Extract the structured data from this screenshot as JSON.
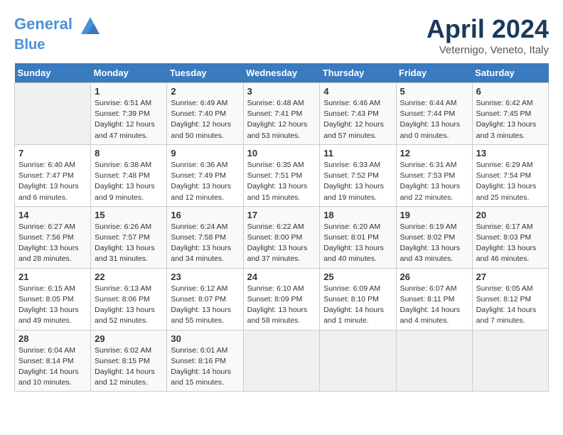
{
  "header": {
    "logo_line1": "General",
    "logo_line2": "Blue",
    "month": "April 2024",
    "location": "Veternigo, Veneto, Italy"
  },
  "weekdays": [
    "Sunday",
    "Monday",
    "Tuesday",
    "Wednesday",
    "Thursday",
    "Friday",
    "Saturday"
  ],
  "weeks": [
    [
      {
        "num": "",
        "sunrise": "",
        "sunset": "",
        "daylight": ""
      },
      {
        "num": "1",
        "sunrise": "Sunrise: 6:51 AM",
        "sunset": "Sunset: 7:39 PM",
        "daylight": "Daylight: 12 hours and 47 minutes."
      },
      {
        "num": "2",
        "sunrise": "Sunrise: 6:49 AM",
        "sunset": "Sunset: 7:40 PM",
        "daylight": "Daylight: 12 hours and 50 minutes."
      },
      {
        "num": "3",
        "sunrise": "Sunrise: 6:48 AM",
        "sunset": "Sunset: 7:41 PM",
        "daylight": "Daylight: 12 hours and 53 minutes."
      },
      {
        "num": "4",
        "sunrise": "Sunrise: 6:46 AM",
        "sunset": "Sunset: 7:43 PM",
        "daylight": "Daylight: 12 hours and 57 minutes."
      },
      {
        "num": "5",
        "sunrise": "Sunrise: 6:44 AM",
        "sunset": "Sunset: 7:44 PM",
        "daylight": "Daylight: 13 hours and 0 minutes."
      },
      {
        "num": "6",
        "sunrise": "Sunrise: 6:42 AM",
        "sunset": "Sunset: 7:45 PM",
        "daylight": "Daylight: 13 hours and 3 minutes."
      }
    ],
    [
      {
        "num": "7",
        "sunrise": "Sunrise: 6:40 AM",
        "sunset": "Sunset: 7:47 PM",
        "daylight": "Daylight: 13 hours and 6 minutes."
      },
      {
        "num": "8",
        "sunrise": "Sunrise: 6:38 AM",
        "sunset": "Sunset: 7:48 PM",
        "daylight": "Daylight: 13 hours and 9 minutes."
      },
      {
        "num": "9",
        "sunrise": "Sunrise: 6:36 AM",
        "sunset": "Sunset: 7:49 PM",
        "daylight": "Daylight: 13 hours and 12 minutes."
      },
      {
        "num": "10",
        "sunrise": "Sunrise: 6:35 AM",
        "sunset": "Sunset: 7:51 PM",
        "daylight": "Daylight: 13 hours and 15 minutes."
      },
      {
        "num": "11",
        "sunrise": "Sunrise: 6:33 AM",
        "sunset": "Sunset: 7:52 PM",
        "daylight": "Daylight: 13 hours and 19 minutes."
      },
      {
        "num": "12",
        "sunrise": "Sunrise: 6:31 AM",
        "sunset": "Sunset: 7:53 PM",
        "daylight": "Daylight: 13 hours and 22 minutes."
      },
      {
        "num": "13",
        "sunrise": "Sunrise: 6:29 AM",
        "sunset": "Sunset: 7:54 PM",
        "daylight": "Daylight: 13 hours and 25 minutes."
      }
    ],
    [
      {
        "num": "14",
        "sunrise": "Sunrise: 6:27 AM",
        "sunset": "Sunset: 7:56 PM",
        "daylight": "Daylight: 13 hours and 28 minutes."
      },
      {
        "num": "15",
        "sunrise": "Sunrise: 6:26 AM",
        "sunset": "Sunset: 7:57 PM",
        "daylight": "Daylight: 13 hours and 31 minutes."
      },
      {
        "num": "16",
        "sunrise": "Sunrise: 6:24 AM",
        "sunset": "Sunset: 7:58 PM",
        "daylight": "Daylight: 13 hours and 34 minutes."
      },
      {
        "num": "17",
        "sunrise": "Sunrise: 6:22 AM",
        "sunset": "Sunset: 8:00 PM",
        "daylight": "Daylight: 13 hours and 37 minutes."
      },
      {
        "num": "18",
        "sunrise": "Sunrise: 6:20 AM",
        "sunset": "Sunset: 8:01 PM",
        "daylight": "Daylight: 13 hours and 40 minutes."
      },
      {
        "num": "19",
        "sunrise": "Sunrise: 6:19 AM",
        "sunset": "Sunset: 8:02 PM",
        "daylight": "Daylight: 13 hours and 43 minutes."
      },
      {
        "num": "20",
        "sunrise": "Sunrise: 6:17 AM",
        "sunset": "Sunset: 8:03 PM",
        "daylight": "Daylight: 13 hours and 46 minutes."
      }
    ],
    [
      {
        "num": "21",
        "sunrise": "Sunrise: 6:15 AM",
        "sunset": "Sunset: 8:05 PM",
        "daylight": "Daylight: 13 hours and 49 minutes."
      },
      {
        "num": "22",
        "sunrise": "Sunrise: 6:13 AM",
        "sunset": "Sunset: 8:06 PM",
        "daylight": "Daylight: 13 hours and 52 minutes."
      },
      {
        "num": "23",
        "sunrise": "Sunrise: 6:12 AM",
        "sunset": "Sunset: 8:07 PM",
        "daylight": "Daylight: 13 hours and 55 minutes."
      },
      {
        "num": "24",
        "sunrise": "Sunrise: 6:10 AM",
        "sunset": "Sunset: 8:09 PM",
        "daylight": "Daylight: 13 hours and 58 minutes."
      },
      {
        "num": "25",
        "sunrise": "Sunrise: 6:09 AM",
        "sunset": "Sunset: 8:10 PM",
        "daylight": "Daylight: 14 hours and 1 minute."
      },
      {
        "num": "26",
        "sunrise": "Sunrise: 6:07 AM",
        "sunset": "Sunset: 8:11 PM",
        "daylight": "Daylight: 14 hours and 4 minutes."
      },
      {
        "num": "27",
        "sunrise": "Sunrise: 6:05 AM",
        "sunset": "Sunset: 8:12 PM",
        "daylight": "Daylight: 14 hours and 7 minutes."
      }
    ],
    [
      {
        "num": "28",
        "sunrise": "Sunrise: 6:04 AM",
        "sunset": "Sunset: 8:14 PM",
        "daylight": "Daylight: 14 hours and 10 minutes."
      },
      {
        "num": "29",
        "sunrise": "Sunrise: 6:02 AM",
        "sunset": "Sunset: 8:15 PM",
        "daylight": "Daylight: 14 hours and 12 minutes."
      },
      {
        "num": "30",
        "sunrise": "Sunrise: 6:01 AM",
        "sunset": "Sunset: 8:16 PM",
        "daylight": "Daylight: 14 hours and 15 minutes."
      },
      {
        "num": "",
        "sunrise": "",
        "sunset": "",
        "daylight": ""
      },
      {
        "num": "",
        "sunrise": "",
        "sunset": "",
        "daylight": ""
      },
      {
        "num": "",
        "sunrise": "",
        "sunset": "",
        "daylight": ""
      },
      {
        "num": "",
        "sunrise": "",
        "sunset": "",
        "daylight": ""
      }
    ]
  ]
}
